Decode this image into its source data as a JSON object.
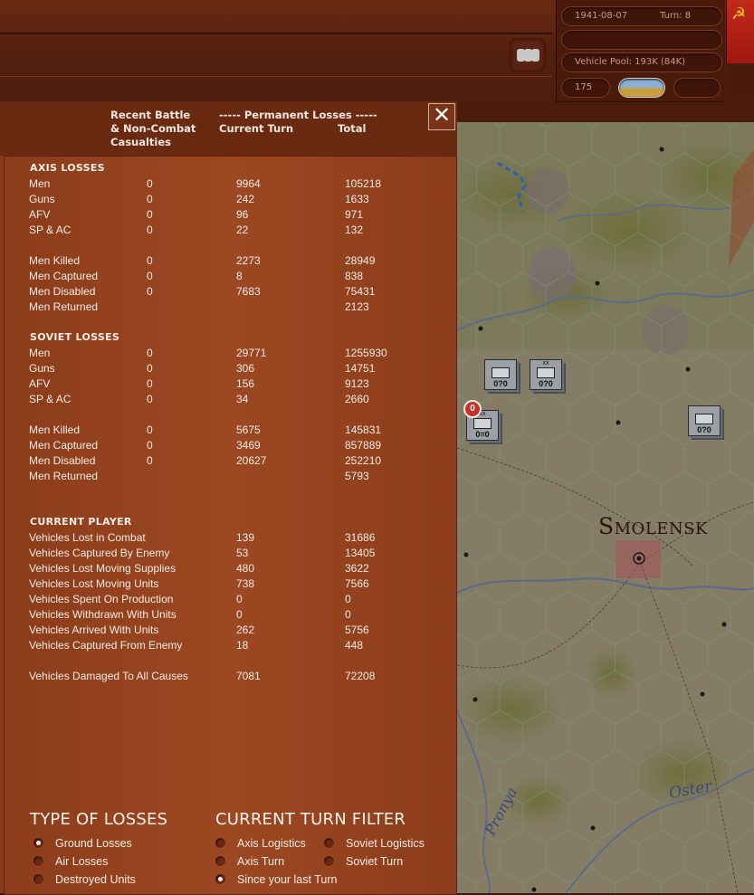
{
  "hud": {
    "date": "1941-08-07",
    "turn": "Turn: 8",
    "vehicle_pool": "Vehicle Pool: 193K (84K)",
    "count": "175"
  },
  "panel": {
    "close_label": "✕",
    "headers": {
      "recent_line1": "Recent Battle",
      "recent_line2": "& Non-Combat",
      "recent_line3": "Casualties",
      "perm": "----- Permanent Losses -----",
      "current_turn": "Current Turn",
      "total": "Total"
    },
    "axis_title": "AXIS LOSSES",
    "axis_rows": [
      {
        "label": "Men",
        "recent": "0",
        "current": "9964",
        "total": "105218"
      },
      {
        "label": "Guns",
        "recent": "0",
        "current": "242",
        "total": "1633"
      },
      {
        "label": "AFV",
        "recent": "0",
        "current": "96",
        "total": "971"
      },
      {
        "label": "SP & AC",
        "recent": "0",
        "current": "22",
        "total": "132"
      },
      {
        "label": "Men Killed",
        "recent": "0",
        "current": "2273",
        "total": "28949"
      },
      {
        "label": "Men Captured",
        "recent": "0",
        "current": "8",
        "total": "838"
      },
      {
        "label": "Men Disabled",
        "recent": "0",
        "current": "7683",
        "total": "75431"
      },
      {
        "label": "Men Returned",
        "recent": "",
        "current": "",
        "total": "2123"
      }
    ],
    "soviet_title": "SOVIET LOSSES",
    "soviet_rows": [
      {
        "label": "Men",
        "recent": "0",
        "current": "29771",
        "total": "1255930"
      },
      {
        "label": "Guns",
        "recent": "0",
        "current": "306",
        "total": "14751"
      },
      {
        "label": "AFV",
        "recent": "0",
        "current": "156",
        "total": "9123"
      },
      {
        "label": "SP & AC",
        "recent": "0",
        "current": "34",
        "total": "2660"
      },
      {
        "label": "Men Killed",
        "recent": "0",
        "current": "5675",
        "total": "145831"
      },
      {
        "label": "Men Captured",
        "recent": "0",
        "current": "3469",
        "total": "857889"
      },
      {
        "label": "Men Disabled",
        "recent": "0",
        "current": "20627",
        "total": "252210"
      },
      {
        "label": "Men Returned",
        "recent": "",
        "current": "",
        "total": "5793"
      }
    ],
    "player_title": "CURRENT PLAYER",
    "player_rows": [
      {
        "label": "Vehicles Lost in Combat",
        "current": "139",
        "total": "31686"
      },
      {
        "label": "Vehicles Captured By Enemy",
        "current": "53",
        "total": "13405"
      },
      {
        "label": "Vehicles Lost Moving Supplies",
        "current": "480",
        "total": "3622"
      },
      {
        "label": "Vehicles Lost Moving Units",
        "current": "738",
        "total": "7566"
      },
      {
        "label": "Vehicles Spent On Production",
        "current": "0",
        "total": "0"
      },
      {
        "label": "Vehicles Withdrawn With Units",
        "current": "0",
        "total": "0"
      },
      {
        "label": "Vehicles Arrived With Units",
        "current": "262",
        "total": "5756"
      },
      {
        "label": "Vehicles Captured From Enemy",
        "current": "18",
        "total": "448"
      },
      {
        "label": "Vehicles Damaged To All Causes",
        "current": "7081",
        "total": "72208"
      }
    ],
    "type_title": "TYPE OF LOSSES",
    "type_options": [
      {
        "label": "Ground Losses",
        "selected": true
      },
      {
        "label": "Air Losses",
        "selected": false
      },
      {
        "label": "Destroyed Units",
        "selected": false
      }
    ],
    "filter_title": "CURRENT TURN FILTER",
    "filter_options": [
      {
        "label": "Axis Logistics",
        "selected": false
      },
      {
        "label": "Soviet Logistics",
        "selected": false
      },
      {
        "label": "Axis Turn",
        "selected": false
      },
      {
        "label": "Soviet Turn",
        "selected": false
      },
      {
        "label": "Since your last Turn",
        "selected": true
      }
    ]
  },
  "map": {
    "city": "Smolensk",
    "river1": "Oster",
    "river2": "Pronya",
    "units": [
      {
        "value": "0?0"
      },
      {
        "value": "0?0"
      },
      {
        "value": "0=0"
      },
      {
        "value": "0?0"
      }
    ],
    "stack_badge": "0",
    "unit_size": "xx"
  }
}
